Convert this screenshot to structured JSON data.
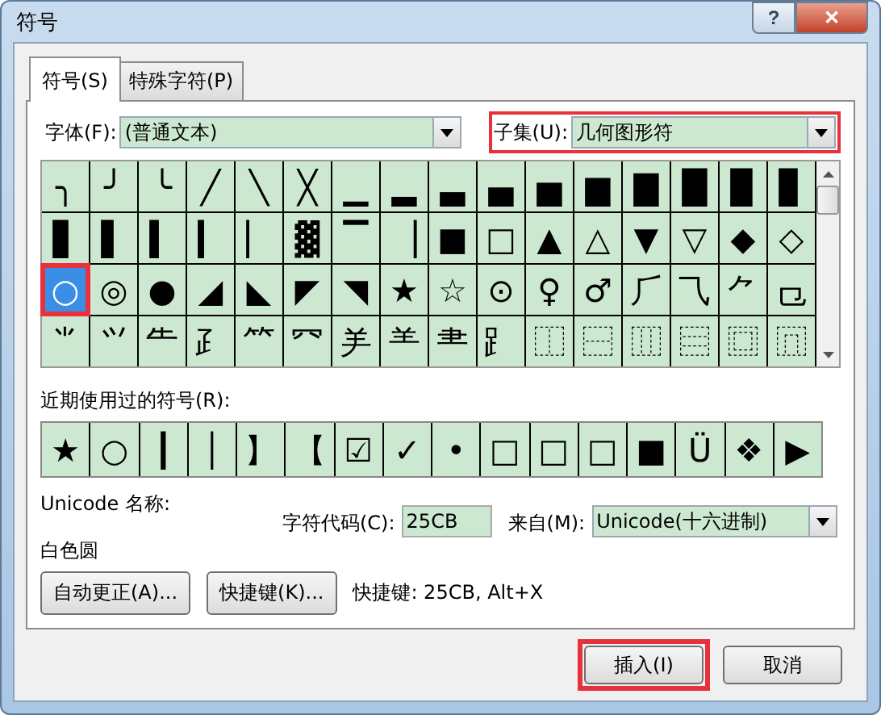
{
  "window": {
    "title": "符号",
    "help_button": "?",
    "close_button": "✕"
  },
  "tabs": [
    {
      "label": "符号(S)",
      "selected": true
    },
    {
      "label": "特殊字符(P)",
      "selected": false
    }
  ],
  "font": {
    "label": "字体(F):",
    "value": "(普通文本)",
    "highlighted": false
  },
  "subset": {
    "label": "子集(U):",
    "value": "几何图形符",
    "highlighted": true
  },
  "symbol_grid": {
    "rows": [
      {
        "cells": [
          {
            "glyph": "╮",
            "selected": false
          },
          {
            "glyph": "╯",
            "selected": false
          },
          {
            "glyph": "╰",
            "selected": false
          },
          {
            "glyph": "╱",
            "selected": false
          },
          {
            "glyph": "╲",
            "selected": false
          },
          {
            "glyph": "╳",
            "selected": false
          },
          {
            "glyph": "▁",
            "selected": false
          },
          {
            "glyph": "▂",
            "selected": false
          },
          {
            "glyph": "▃",
            "selected": false
          },
          {
            "glyph": "▄",
            "selected": false
          },
          {
            "glyph": "▅",
            "selected": false
          },
          {
            "glyph": "▆",
            "selected": false
          },
          {
            "glyph": "▇",
            "selected": false
          },
          {
            "glyph": "█",
            "selected": false
          },
          {
            "glyph": "▉",
            "selected": false
          },
          {
            "glyph": "▊",
            "selected": false
          }
        ]
      },
      {
        "cells": [
          {
            "glyph": "▋",
            "selected": false
          },
          {
            "glyph": "▌",
            "selected": false
          },
          {
            "glyph": "▍",
            "selected": false
          },
          {
            "glyph": "▎",
            "selected": false
          },
          {
            "glyph": "▏",
            "selected": false
          },
          {
            "glyph": "▓",
            "selected": false
          },
          {
            "glyph": "▔",
            "selected": false
          },
          {
            "glyph": "▕",
            "selected": false
          },
          {
            "glyph": "■",
            "selected": false
          },
          {
            "glyph": "□",
            "selected": false
          },
          {
            "glyph": "▲",
            "selected": false
          },
          {
            "glyph": "△",
            "selected": false
          },
          {
            "glyph": "▼",
            "selected": false
          },
          {
            "glyph": "▽",
            "selected": false
          },
          {
            "glyph": "◆",
            "selected": false
          },
          {
            "glyph": "◇",
            "selected": false
          }
        ]
      },
      {
        "cells": [
          {
            "glyph": "○",
            "selected": true
          },
          {
            "glyph": "◎",
            "selected": false
          },
          {
            "glyph": "●",
            "selected": false
          },
          {
            "glyph": "◢",
            "selected": false
          },
          {
            "glyph": "◣",
            "selected": false
          },
          {
            "glyph": "◤",
            "selected": false
          },
          {
            "glyph": "◥",
            "selected": false
          },
          {
            "glyph": "★",
            "selected": false
          },
          {
            "glyph": "☆",
            "selected": false
          },
          {
            "glyph": "⊙",
            "selected": false
          },
          {
            "glyph": "♀",
            "selected": false
          },
          {
            "glyph": "♂",
            "selected": false
          },
          {
            "glyph": "⺁",
            "selected": false
          },
          {
            "glyph": "⺄",
            "selected": false
          },
          {
            "glyph": "⺈",
            "selected": false
          },
          {
            "glyph": "⺋",
            "selected": false
          }
        ]
      },
      {
        "cells": [
          {
            "glyph": "⺌",
            "selected": false
          },
          {
            "glyph": "⺍",
            "selected": false
          },
          {
            "glyph": "⺧",
            "selected": false
          },
          {
            "glyph": "⺪",
            "selected": false
          },
          {
            "glyph": "⺮",
            "selected": false
          },
          {
            "glyph": "⺳",
            "selected": false
          },
          {
            "glyph": "⺶",
            "selected": false
          },
          {
            "glyph": "⺷",
            "selected": false
          },
          {
            "glyph": "⺻",
            "selected": false
          },
          {
            "glyph": "⻊",
            "selected": false
          },
          {
            "glyph": "⿰",
            "selected": false
          },
          {
            "glyph": "⿱",
            "selected": false
          },
          {
            "glyph": "⿲",
            "selected": false
          },
          {
            "glyph": "⿳",
            "selected": false
          },
          {
            "glyph": "⿴",
            "selected": false
          },
          {
            "glyph": "⿵",
            "selected": false
          }
        ]
      }
    ]
  },
  "recent": {
    "label": "近期使用过的符号(R):",
    "symbols": [
      "★",
      "○",
      "┃",
      "│",
      "】",
      "【",
      "☑",
      "✓",
      "•",
      "□",
      "□",
      "□",
      "■",
      "Ü",
      "❖",
      "▶"
    ]
  },
  "unicode_name": {
    "label": "Unicode 名称:",
    "value": "白色圆"
  },
  "char_code": {
    "label": "字符代码(C):",
    "value": "25CB"
  },
  "from": {
    "label": "来自(M):",
    "value": "Unicode(十六进制)"
  },
  "autocorrect_button": "自动更正(A)...",
  "shortcut_button": "快捷键(K)...",
  "shortcut_text": "快捷键: 25CB, Alt+X",
  "buttons": [
    {
      "label": "插入(I)",
      "highlighted": true
    },
    {
      "label": "取消",
      "highlighted": false
    }
  ]
}
